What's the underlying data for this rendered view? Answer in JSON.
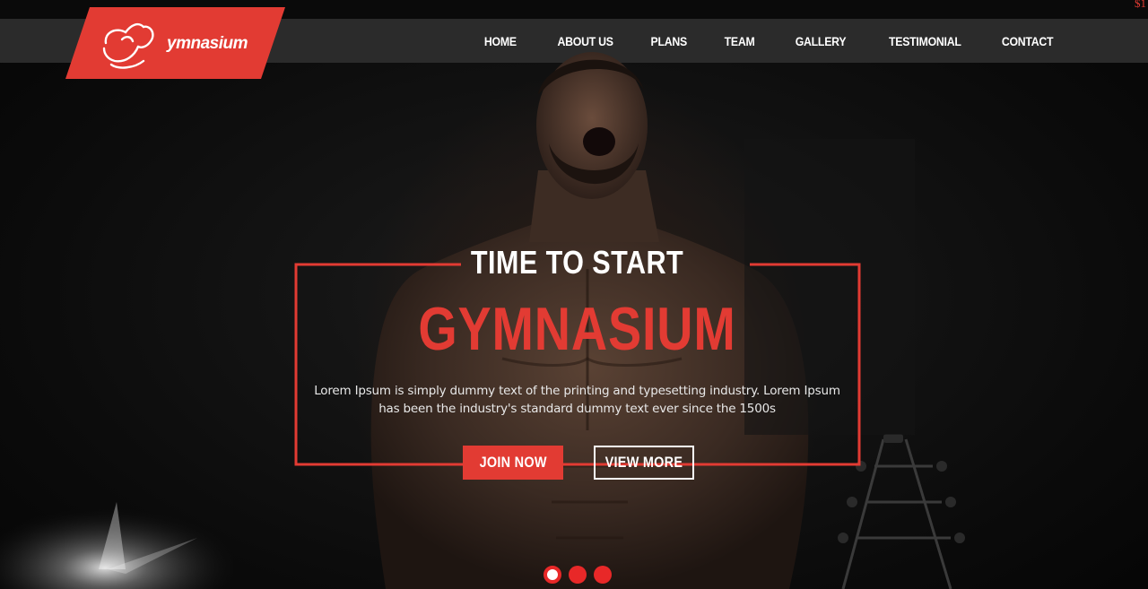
{
  "corner_text": "$1",
  "logo": {
    "text": "ymnasium",
    "icon": "flexed-arm-icon"
  },
  "nav": {
    "items": [
      {
        "label": "HOME"
      },
      {
        "label": "ABOUT US"
      },
      {
        "label": "PLANS"
      },
      {
        "label": "TEAM"
      },
      {
        "label": "GALLERY"
      },
      {
        "label": "TESTIMONIAL"
      },
      {
        "label": "CONTACT"
      }
    ]
  },
  "hero": {
    "kicker": "TIME TO START",
    "title": "GYMNASIUM",
    "description": "Lorem Ipsum is simply dummy text of the printing and typesetting industry. Lorem Ipsum has been the industry's standard dummy text ever since the 1500s",
    "join_label": "JOIN NOW",
    "more_label": "VIEW MORE"
  },
  "slider": {
    "count": 3,
    "active_index": 0
  },
  "colors": {
    "accent": "#e23b33",
    "navbar": "#2b2b2b",
    "background": "#0b0b0b"
  }
}
